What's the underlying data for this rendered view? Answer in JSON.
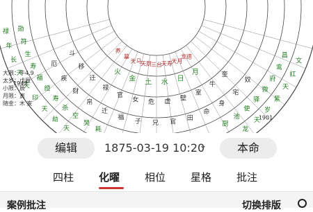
{
  "chart": {
    "outer_sectors": [
      "禄勋",
      "年符",
      "长生",
      "天寿",
      "天福",
      "印绶",
      "天寿",
      "劫杀",
      "天空",
      "天哭",
      "大耗",
      "伏兵",
      "天伤",
      "旬空",
      "天德",
      "天官",
      "天贵",
      "月德",
      "禄存",
      "华盖",
      "天厨",
      "龙池",
      "天使",
      "岁驿",
      "紫微",
      "天府",
      "红鸾",
      "文昌"
    ],
    "middle_stars": [
      "厄",
      "疾",
      "财",
      "帛",
      "迁",
      "福",
      "子",
      "兄",
      "官",
      "田",
      "命",
      "身",
      "宅",
      "奴"
    ],
    "inner_ring": [
      "斗",
      "移",
      "迁",
      "禄",
      "官",
      "女",
      "危",
      "虚",
      "壁",
      "室",
      "牛",
      "奎"
    ],
    "ages": [
      "1942",
      "1935",
      "1927",
      "1912",
      "1901"
    ],
    "center_elements": [
      "火",
      "金",
      "土",
      "水",
      "日",
      "月"
    ],
    "labels_bottom": [
      "养",
      "墓",
      "天马",
      "天厨",
      "三台",
      "天寿",
      "天月",
      "龙德"
    ]
  },
  "info": [
    {
      "label": "大限",
      "value": "牛4.9"
    },
    {
      "label": "太岁",
      "value": "戊辰"
    },
    {
      "label": "小限",
      "value": "辰"
    },
    {
      "label": "月限",
      "value": "寅"
    },
    {
      "label": "随金",
      "value": "木 亥"
    }
  ],
  "toolbar": {
    "edit_label": "编辑",
    "date": "1875-03-19 10:20",
    "chevron": "chevron-down-icon",
    "mode_label": "本命"
  },
  "tabs": [
    "四柱",
    "化曜",
    "相位",
    "星格",
    "批注"
  ],
  "footer": {
    "left_label": "案例批注",
    "right_label": "切换排版"
  }
}
